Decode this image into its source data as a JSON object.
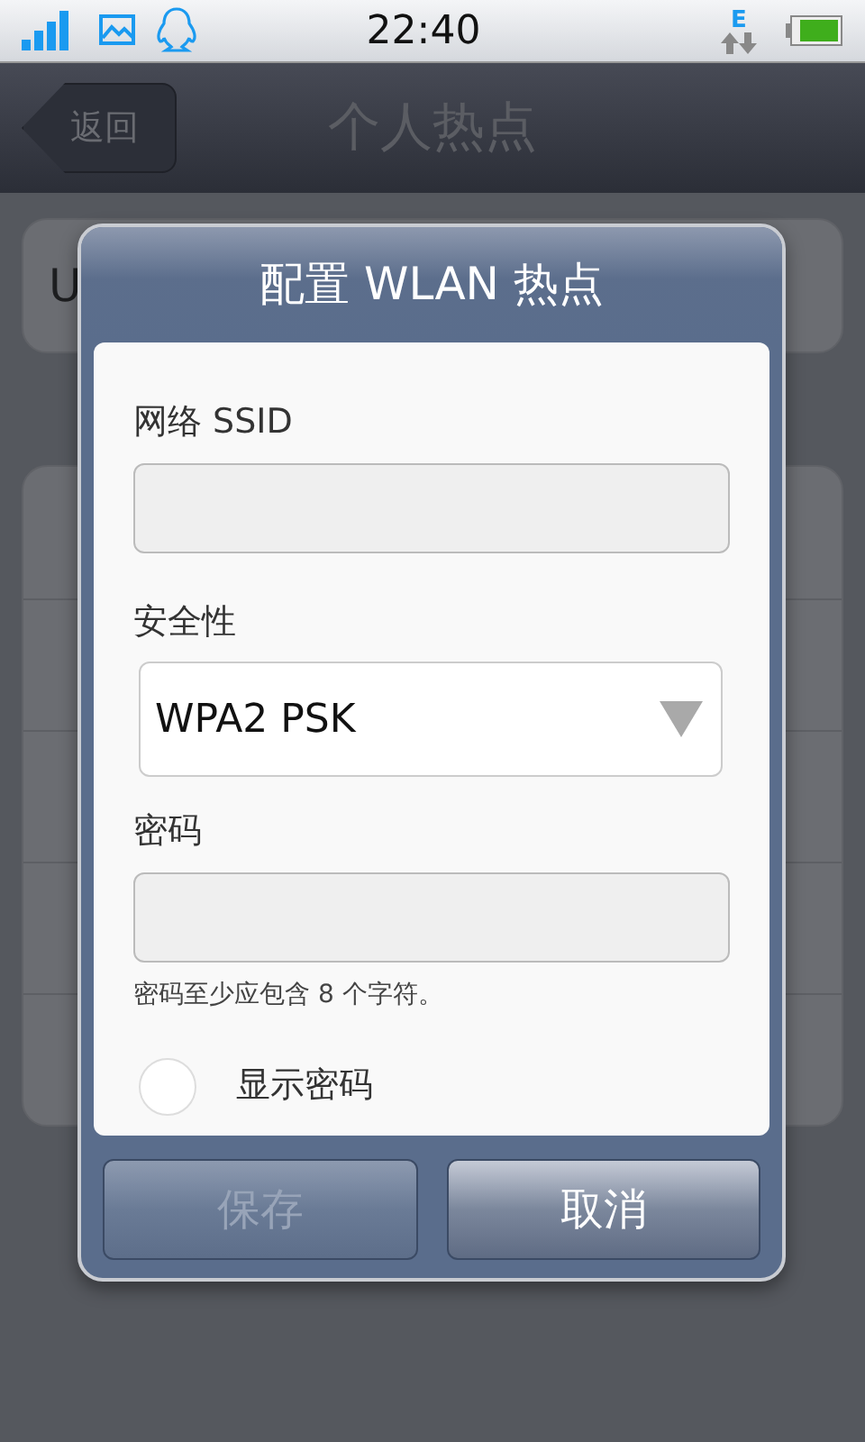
{
  "status_bar": {
    "time": "22:40",
    "network_type": "E"
  },
  "nav_bar": {
    "back_button": "返回",
    "title": "个人热点"
  },
  "background_groups": [
    {
      "rows": [
        {
          "label": "U",
          "kind": "labeled"
        }
      ]
    },
    {
      "rows": [
        {
          "kind": "blank"
        },
        {
          "kind": "blank"
        },
        {
          "kind": "blank"
        },
        {
          "kind": "blank"
        },
        {
          "kind": "blank"
        }
      ]
    }
  ],
  "dialog": {
    "title": "配置 WLAN 热点",
    "ssid": {
      "label": "网络 SSID"
    },
    "security": {
      "label": "安全性",
      "value": "WPA2 PSK"
    },
    "password": {
      "label": "密码",
      "hint": "密码至少应包含 8 个字符。"
    },
    "show_password": {
      "label": "显示密码",
      "checked": false
    },
    "buttons": [
      {
        "label": "保存",
        "disabled": true
      },
      {
        "label": "取消",
        "disabled": false
      }
    ]
  }
}
